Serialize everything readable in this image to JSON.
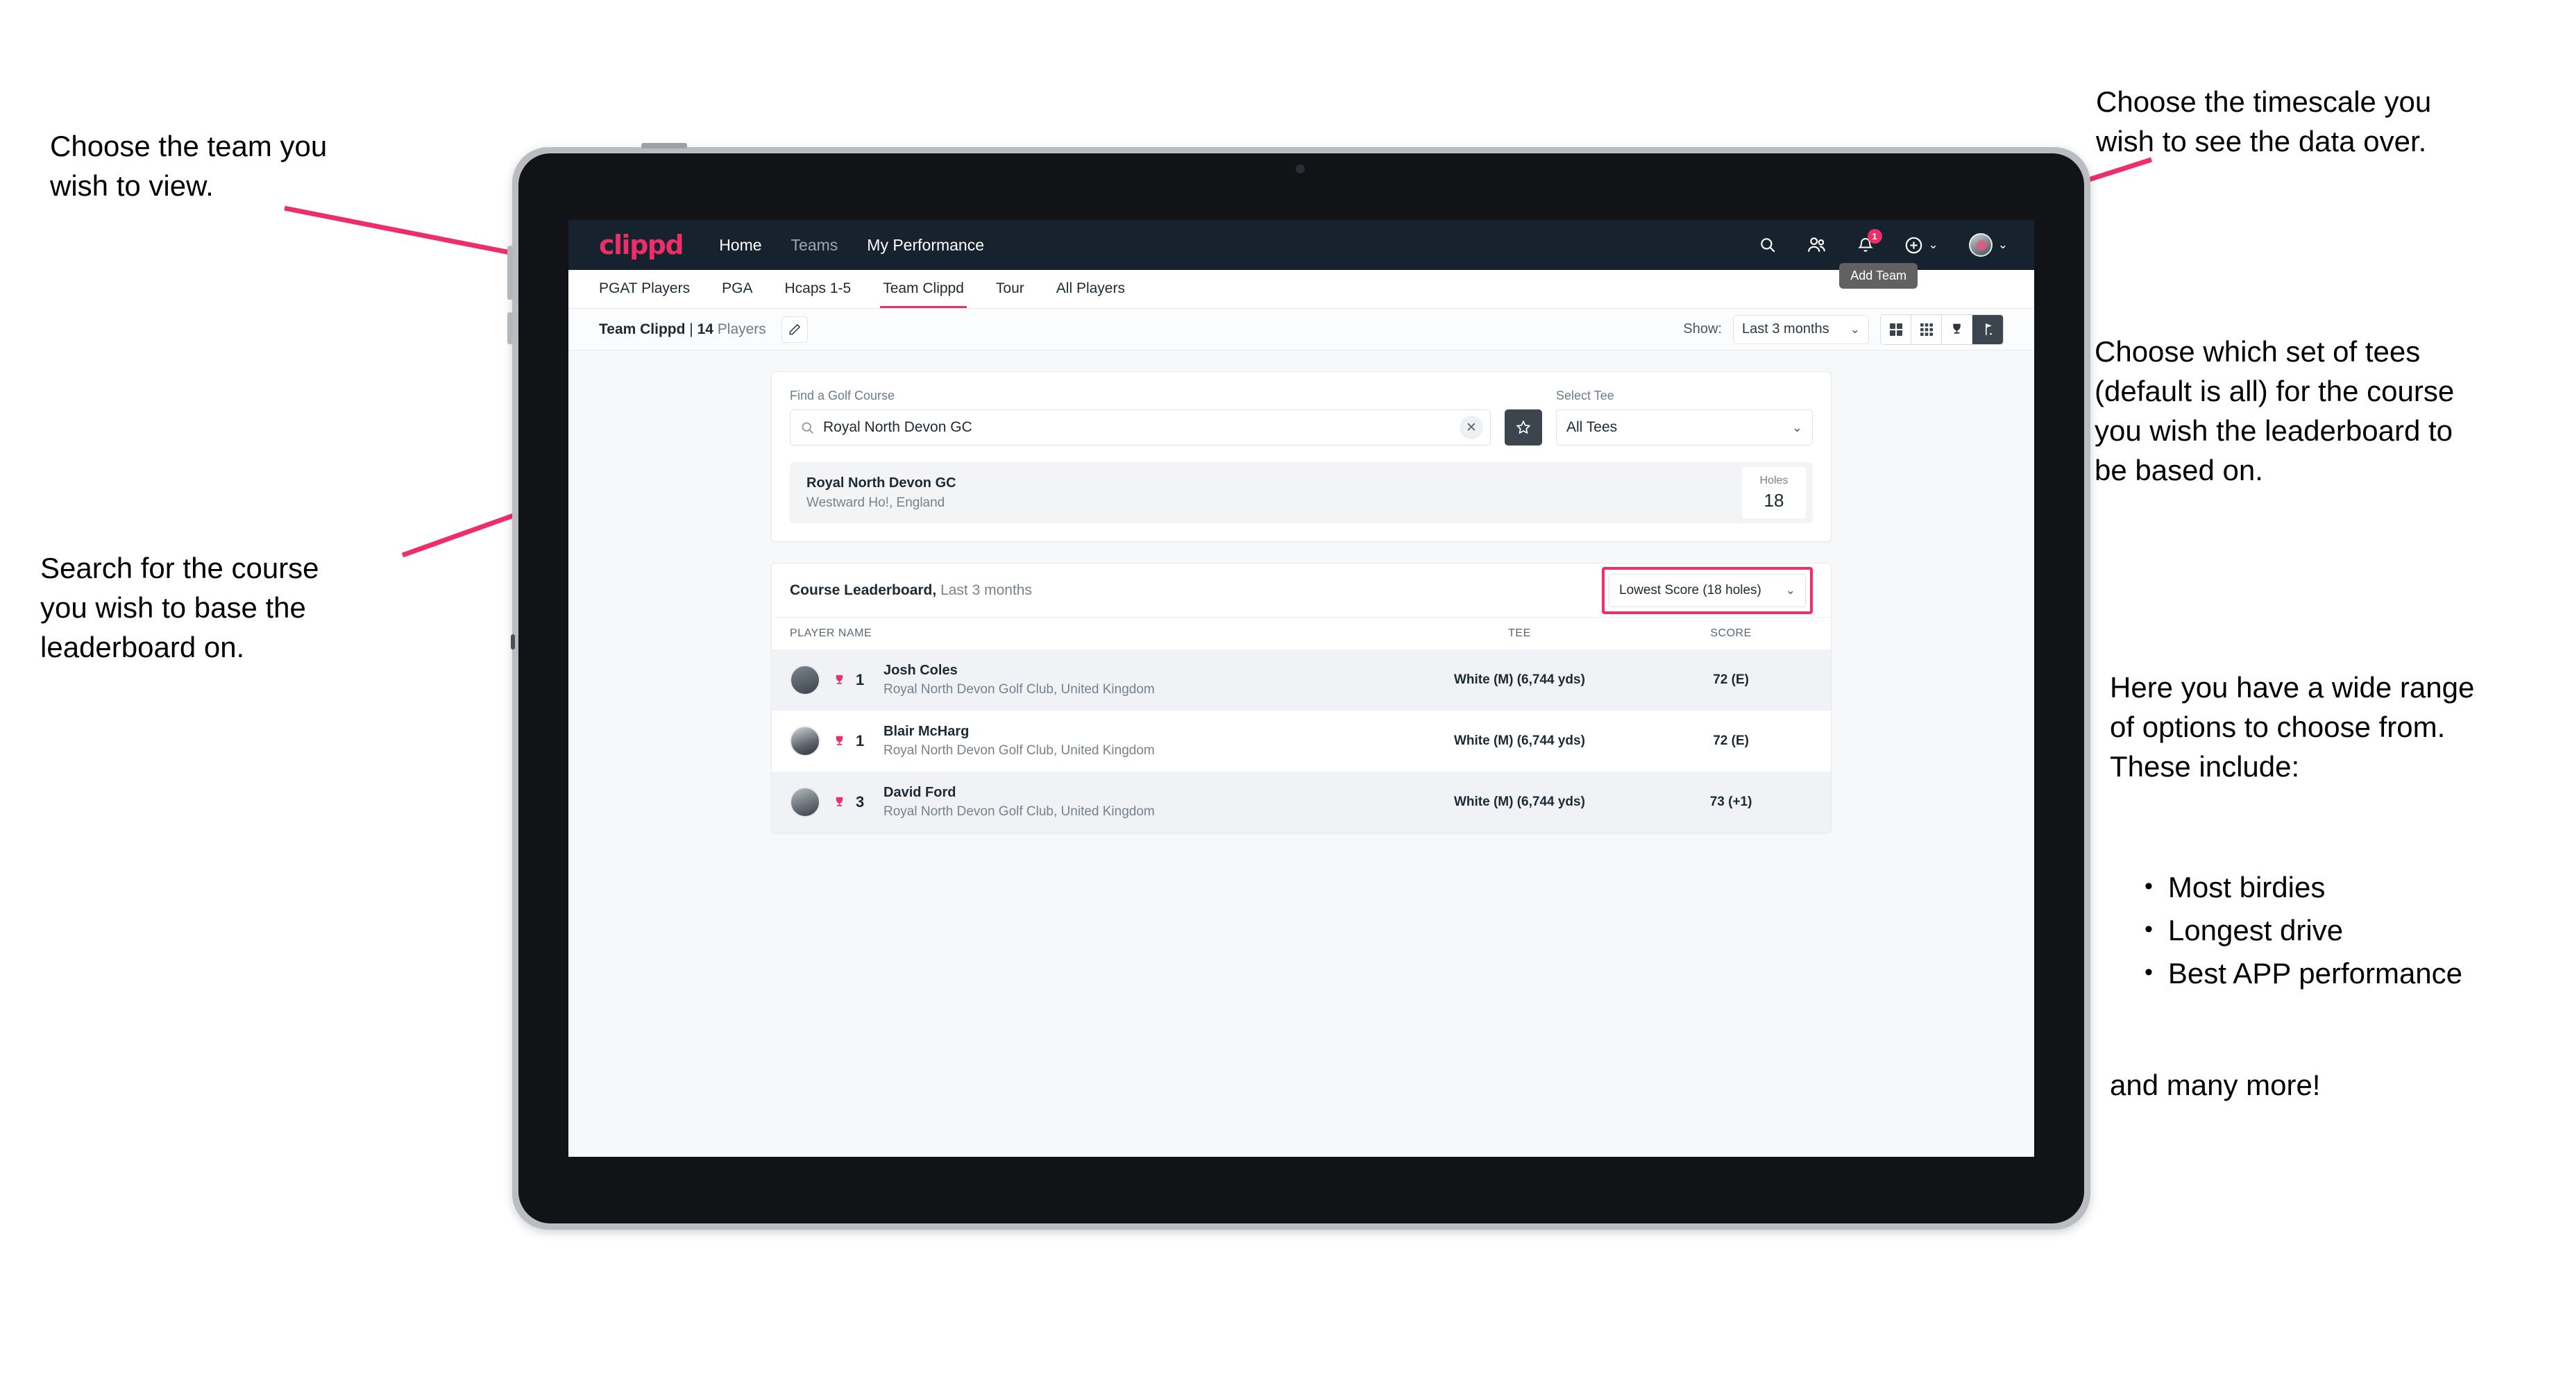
{
  "annotations": {
    "top_left": "Choose the team you\nwish to view.",
    "bottom_left": "Search for the course\nyou wish to base the\nleaderboard on.",
    "top_right": "Choose the timescale you\nwish to see the data over.",
    "right_tees": "Choose which set of tees\n(default is all) for the course\nyou wish the leaderboard to\nbe based on.",
    "right_options_intro": "Here you have a wide range\nof options to choose from.\nThese include:",
    "right_options_bullets": [
      "Most birdies",
      "Longest drive",
      "Best APP performance"
    ],
    "right_options_tail": "and many more!"
  },
  "app": {
    "navbar": {
      "logo": "clippd",
      "links": [
        {
          "label": "Home",
          "muted": false
        },
        {
          "label": "Teams",
          "muted": true
        },
        {
          "label": "My Performance",
          "muted": false
        }
      ],
      "icons": [
        "search-icon",
        "people-icon",
        "notifications-icon",
        "add-icon",
        "account-icon"
      ],
      "notification_count": "1",
      "tooltip": "Add Team"
    },
    "tabs": [
      {
        "label": "PGAT Players",
        "active": false,
        "muted": false
      },
      {
        "label": "PGA",
        "active": false,
        "muted": false
      },
      {
        "label": "Hcaps 1-5",
        "active": false,
        "muted": false
      },
      {
        "label": "Team Clippd",
        "active": true,
        "muted": true
      },
      {
        "label": "Tour",
        "active": false,
        "muted": false
      },
      {
        "label": "All Players",
        "active": false,
        "muted": false
      }
    ],
    "toolbar": {
      "team_name": "Team Clippd",
      "separator": " | ",
      "player_count": "14",
      "players_word": " Players",
      "edit_icon": "pencil-icon",
      "show_label": "Show:",
      "timescale_value": "Last 3 months",
      "views": [
        {
          "name": "grid-2x2-view",
          "active": false
        },
        {
          "name": "grid-3x3-view",
          "active": false
        },
        {
          "name": "trophy-view",
          "active": false
        },
        {
          "name": "golf-flag-view",
          "active": true
        }
      ]
    },
    "search": {
      "course_label": "Find a Golf Course",
      "course_value": "Royal North Devon GC",
      "course_placeholder": "Find a Golf Course",
      "clear_icon": "close-icon",
      "favorite_icon": "star-icon",
      "tee_label": "Select Tee",
      "tee_value": "All Tees"
    },
    "course_result": {
      "name": "Royal North Devon GC",
      "location": "Westward Ho!, England",
      "holes_label": "Holes",
      "holes_value": "18"
    },
    "leaderboard": {
      "title": "Course Leaderboard,",
      "subtitle": " Last 3 months",
      "metric_value": "Lowest Score (18 holes)",
      "columns": [
        "PLAYER NAME",
        "TEE",
        "SCORE"
      ],
      "rows": [
        {
          "rank": "1",
          "name": "Josh Coles",
          "club": "Royal North Devon Golf Club, United Kingdom",
          "tee": "White (M) (6,744 yds)",
          "score": "72 (E)"
        },
        {
          "rank": "1",
          "name": "Blair McHarg",
          "club": "Royal North Devon Golf Club, United Kingdom",
          "tee": "White (M) (6,744 yds)",
          "score": "72 (E)"
        },
        {
          "rank": "3",
          "name": "David Ford",
          "club": "Royal North Devon Golf Club, United Kingdom",
          "tee": "White (M) (6,744 yds)",
          "score": "73 (+1)"
        }
      ]
    }
  },
  "colors": {
    "brand_pink": "#ee2e67",
    "navbar_dark": "#16222e",
    "active_toggle": "#3c454e",
    "page_bg": "#f7f8fa"
  }
}
